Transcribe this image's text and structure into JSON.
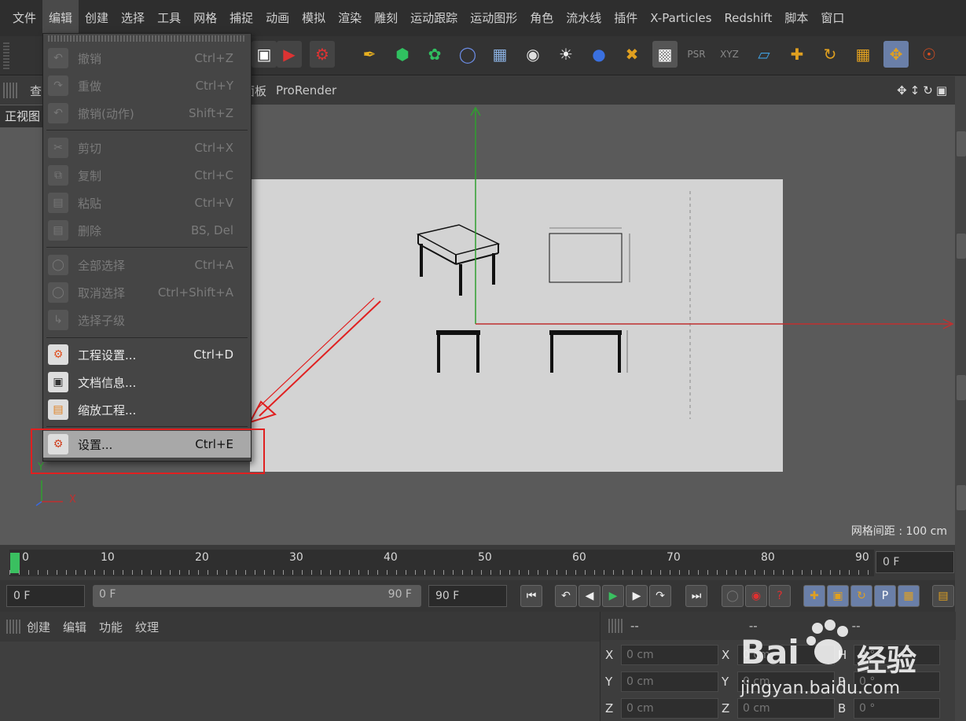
{
  "menubar": [
    "文件",
    "编辑",
    "创建",
    "选择",
    "工具",
    "网格",
    "捕捉",
    "动画",
    "模拟",
    "渲染",
    "雕刻",
    "运动跟踪",
    "运动图形",
    "角色",
    "流水线",
    "插件",
    "X-Particles",
    "Redshift",
    "脚本",
    "窗口"
  ],
  "viewport": {
    "menu": [
      "查",
      "面板",
      "ProRender"
    ],
    "label": "正视图",
    "grid_spacing": "网格间距 : 100 cm",
    "axis_x": "X",
    "axis_y": "Y"
  },
  "edit_menu": {
    "items": [
      {
        "label": "撤销",
        "shortcut": "Ctrl+Z",
        "enabled": false
      },
      {
        "label": "重做",
        "shortcut": "Ctrl+Y",
        "enabled": false
      },
      {
        "label": "撤销(动作)",
        "shortcut": "Shift+Z",
        "enabled": false
      },
      {
        "label": "剪切",
        "shortcut": "Ctrl+X",
        "enabled": false
      },
      {
        "label": "复制",
        "shortcut": "Ctrl+C",
        "enabled": false
      },
      {
        "label": "粘贴",
        "shortcut": "Ctrl+V",
        "enabled": false
      },
      {
        "label": "删除",
        "shortcut": "BS, Del",
        "enabled": false
      },
      {
        "label": "全部选择",
        "shortcut": "Ctrl+A",
        "enabled": false
      },
      {
        "label": "取消选择",
        "shortcut": "Ctrl+Shift+A",
        "enabled": false
      },
      {
        "label": "选择子级",
        "shortcut": "",
        "enabled": false
      },
      {
        "label": "工程设置...",
        "shortcut": "Ctrl+D",
        "enabled": true
      },
      {
        "label": "文档信息...",
        "shortcut": "",
        "enabled": true
      },
      {
        "label": "缩放工程...",
        "shortcut": "",
        "enabled": true
      },
      {
        "label": "设置...",
        "shortcut": "Ctrl+E",
        "enabled": true,
        "highlighted": true
      }
    ]
  },
  "timeline": {
    "ticks": [
      "0",
      "10",
      "20",
      "30",
      "40",
      "50",
      "60",
      "70",
      "80",
      "90"
    ],
    "current_frame": "0 F"
  },
  "transport": {
    "start": "0 F",
    "range_start": "0 F",
    "range_end": "90 F",
    "end": "90 F"
  },
  "material_panel": {
    "menu": [
      "创建",
      "编辑",
      "功能",
      "纹理"
    ]
  },
  "coord_panel": {
    "header_dashes": [
      "--",
      "--",
      "--"
    ],
    "rows": [
      {
        "axis": "X",
        "pos": "0 cm",
        "axis2": "X",
        "size": "0 cm",
        "axis3": "H",
        "rot": "0 °"
      },
      {
        "axis": "Y",
        "pos": "0 cm",
        "axis2": "Y",
        "size": "0 cm",
        "axis3": "P",
        "rot": "0 °"
      },
      {
        "axis": "Z",
        "pos": "0 cm",
        "axis2": "Z",
        "size": "0 cm",
        "axis3": "B",
        "rot": "0 °"
      }
    ]
  },
  "watermark": {
    "brand": "Bai",
    "brand2": "经验",
    "url": "jingyan.baidu.com"
  },
  "colors": {
    "accent_red": "#e02020",
    "axis_green": "#2fa02f",
    "axis_red": "#c03030"
  }
}
